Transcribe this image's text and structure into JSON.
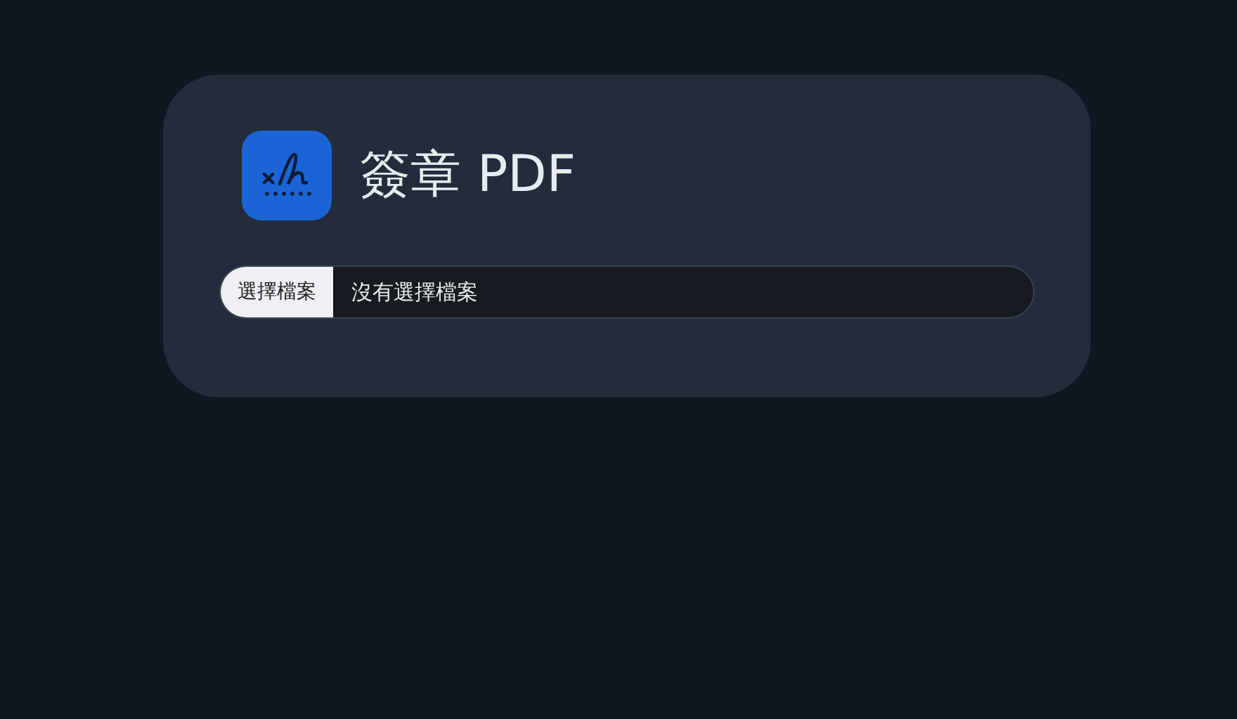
{
  "app": {
    "title": "簽章 PDF"
  },
  "file_input": {
    "button_label": "選擇檔案",
    "status": "沒有選擇檔案"
  }
}
